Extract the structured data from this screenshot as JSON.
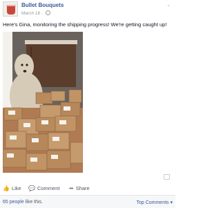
{
  "post": {
    "page_name": "Bullet Bouquets",
    "date": "March 18",
    "caption": "Here's Gina, monitoring the shipping progress! We're getting caught up!",
    "photo_alt": "Dog sitting among stacked shipping boxes"
  },
  "actions": {
    "like": "Like",
    "comment": "Comment",
    "share": "Share"
  },
  "footer": {
    "likes_count": "65 people",
    "likes_suffix": " like this.",
    "top_comments": "Top Comments ▾"
  },
  "icons": {
    "like": "thumb-icon",
    "comment": "speech-bubble-icon",
    "share": "arrow-icon",
    "menu": "chevron-down-icon"
  },
  "colors": {
    "link": "#3b5998",
    "muted": "#9197a3"
  }
}
